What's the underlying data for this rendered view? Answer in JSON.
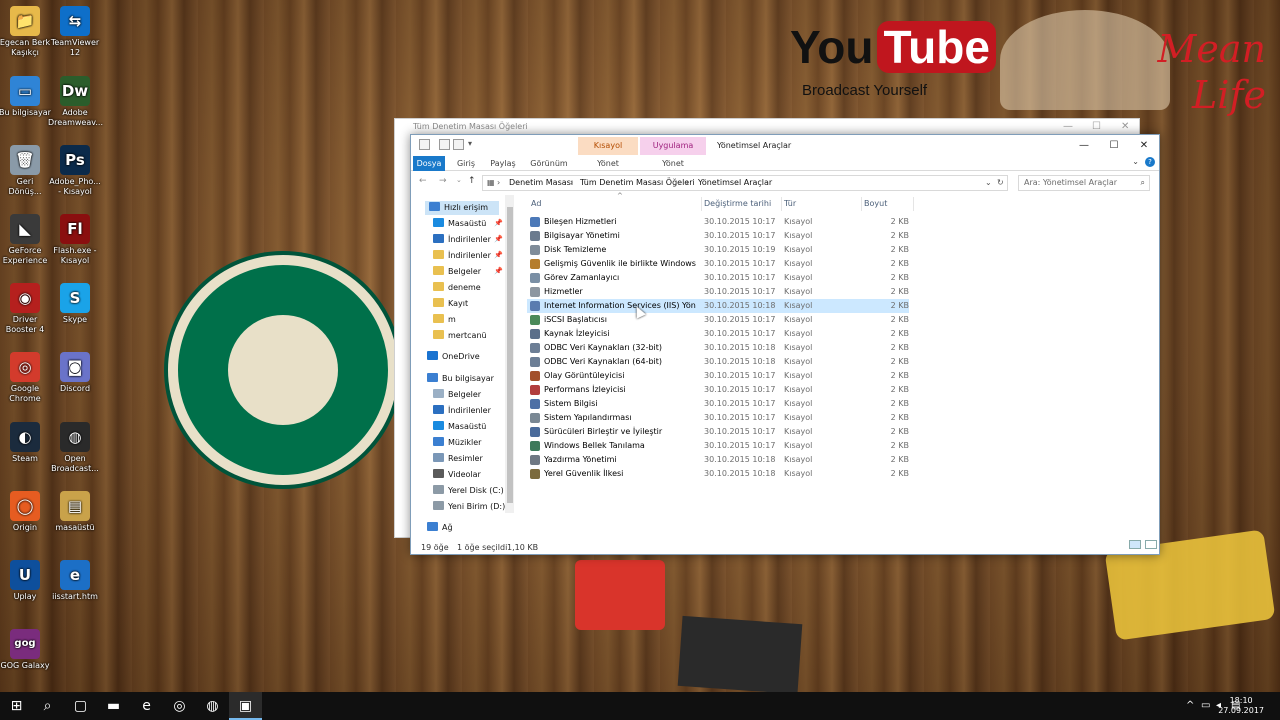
{
  "desktop": {
    "background_text": {
      "youtube_a": "You",
      "youtube_b": "Tube",
      "broadcast": "Broadcast Yourself",
      "mean": "Mean",
      "life": "Life"
    },
    "icons": [
      {
        "label": "Egecan Berk\nKaşıkçı",
        "glyph": "📁",
        "color": "#e7b94a"
      },
      {
        "label": "TeamViewer\n12",
        "glyph": "⇆",
        "color": "#0e6fc9"
      },
      {
        "label": "Bu bilgisayar",
        "glyph": "▭",
        "color": "#2f84d6"
      },
      {
        "label": "Adobe\nDreamweav...",
        "glyph": "Dw",
        "color": "#2b5d2b"
      },
      {
        "label": "Geri\nDönüş...",
        "glyph": "🗑",
        "color": "#8a9aa8"
      },
      {
        "label": "Adobe_Pho...\n- Kısayol",
        "glyph": "Ps",
        "color": "#0b2a4a"
      },
      {
        "label": "GeForce\nExperience",
        "glyph": "◣",
        "color": "#3a3a3a"
      },
      {
        "label": "Flash.exe -\nKısayol",
        "glyph": "Fl",
        "color": "#8a0f0f"
      },
      {
        "label": "Driver\nBooster 4",
        "glyph": "◉",
        "color": "#b5201e"
      },
      {
        "label": "Skype",
        "glyph": "S",
        "color": "#1aa3e8"
      },
      {
        "label": "Google\nChrome",
        "glyph": "◎",
        "color": "#d33b2c"
      },
      {
        "label": "Discord",
        "glyph": "◙",
        "color": "#6a73c9"
      },
      {
        "label": "Steam",
        "glyph": "◐",
        "color": "#1b2b3d"
      },
      {
        "label": "Open\nBroadcast...",
        "glyph": "◍",
        "color": "#2a2a2a"
      },
      {
        "label": "Origin",
        "glyph": "◯",
        "color": "#e65c21"
      },
      {
        "label": "masaüstü",
        "glyph": "▤",
        "color": "#c9a24a"
      },
      {
        "label": "Uplay",
        "glyph": "U",
        "color": "#0e4f9c"
      },
      {
        "label": "iisstart.htm",
        "glyph": "e",
        "color": "#1c6fc6"
      },
      {
        "label": "GOG Galaxy",
        "glyph": "gog",
        "color": "#7a2c7d"
      }
    ]
  },
  "ghost_window": {
    "title": "Tüm Denetim Masası Öğeleri"
  },
  "window": {
    "context_tabs": {
      "a": "Kısayol Araçları",
      "b": "Uygulama Araçları"
    },
    "title": "Yönetimsel Araçlar",
    "controls": {
      "minimize": "—",
      "maximize": "☐",
      "close": "✕"
    },
    "ribbon": {
      "tabs": [
        "Dosya",
        "Giriş",
        "Paylaş",
        "Görünüm",
        "Yönet",
        "Yönet"
      ]
    },
    "address": {
      "crumbs": [
        "Denetim Masası",
        "Tüm Denetim Masası Öğeleri",
        "Yönetimsel Araçlar"
      ],
      "search_placeholder": "Ara: Yönetimsel Araçlar"
    },
    "nav": [
      {
        "label": "Hızlı erişim",
        "color": "#3b7fd1",
        "selected": true
      },
      {
        "label": "Masaüstü",
        "color": "#1a8be0",
        "pin": true
      },
      {
        "label": "İndirilenler",
        "color": "#2b6fc0",
        "pin": true
      },
      {
        "label": "İndirilenler",
        "color": "#e9c050",
        "pin": true
      },
      {
        "label": "Belgeler",
        "color": "#e9c050",
        "pin": true
      },
      {
        "label": "deneme",
        "color": "#e9c050"
      },
      {
        "label": "Kayıt",
        "color": "#e9c050"
      },
      {
        "label": "m",
        "color": "#e9c050"
      },
      {
        "label": "mertcanü",
        "color": "#e9c050"
      },
      {
        "label": "OneDrive",
        "color": "#1a73d0"
      },
      {
        "label": "Bu bilgisayar",
        "color": "#3b7fd1"
      },
      {
        "label": "Belgeler",
        "color": "#9bb0c5"
      },
      {
        "label": "İndirilenler",
        "color": "#2b6fc0"
      },
      {
        "label": "Masaüstü",
        "color": "#1a8be0"
      },
      {
        "label": "Müzikler",
        "color": "#3b7fd1"
      },
      {
        "label": "Resimler",
        "color": "#7a97b7"
      },
      {
        "label": "Videolar",
        "color": "#5a5a5a"
      },
      {
        "label": "Yerel Disk (C:)",
        "color": "#8c9aa6"
      },
      {
        "label": "Yeni Birim (D:)",
        "color": "#8c9aa6"
      },
      {
        "label": "Ağ",
        "color": "#3b7fd1"
      }
    ],
    "columns": {
      "name": "Ad",
      "date": "Değiştirme tarihi",
      "type": "Tür",
      "size": "Boyut"
    },
    "rows": [
      {
        "name": "Bileşen Hizmetleri",
        "date": "30.10.2015 10:17",
        "type": "Kısayol",
        "size": "2 KB",
        "color": "#4c79b8"
      },
      {
        "name": "Bilgisayar Yönetimi",
        "date": "30.10.2015 10:17",
        "type": "Kısayol",
        "size": "2 KB",
        "color": "#6b7b8e"
      },
      {
        "name": "Disk Temizleme",
        "date": "30.10.2015 10:19",
        "type": "Kısayol",
        "size": "2 KB",
        "color": "#7f8c99"
      },
      {
        "name": "Gelişmiş Güvenlik ile birlikte Windows Gü...",
        "date": "30.10.2015 10:17",
        "type": "Kısayol",
        "size": "2 KB",
        "color": "#b57d2c"
      },
      {
        "name": "Görev Zamanlayıcı",
        "date": "30.10.2015 10:17",
        "type": "Kısayol",
        "size": "2 KB",
        "color": "#7a8fa5"
      },
      {
        "name": "Hizmetler",
        "date": "30.10.2015 10:17",
        "type": "Kısayol",
        "size": "2 KB",
        "color": "#8d96a0"
      },
      {
        "name": "Internet Information Services (IIS) Yönetic...",
        "date": "30.10.2015 10:18",
        "type": "Kısayol",
        "size": "2 KB",
        "color": "#5a7cb0",
        "selected": true
      },
      {
        "name": "iSCSI Başlatıcısı",
        "date": "30.10.2015 10:17",
        "type": "Kısayol",
        "size": "2 KB",
        "color": "#4a8a5a"
      },
      {
        "name": "Kaynak İzleyicisi",
        "date": "30.10.2015 10:17",
        "type": "Kısayol",
        "size": "2 KB",
        "color": "#5b6f8a"
      },
      {
        "name": "ODBC Veri Kaynakları (32-bit)",
        "date": "30.10.2015 10:18",
        "type": "Kısayol",
        "size": "2 KB",
        "color": "#6c7e95"
      },
      {
        "name": "ODBC Veri Kaynakları (64-bit)",
        "date": "30.10.2015 10:18",
        "type": "Kısayol",
        "size": "2 KB",
        "color": "#6c7e95"
      },
      {
        "name": "Olay Görüntüleyicisi",
        "date": "30.10.2015 10:17",
        "type": "Kısayol",
        "size": "2 KB",
        "color": "#a2502b"
      },
      {
        "name": "Performans İzleyicisi",
        "date": "30.10.2015 10:17",
        "type": "Kısayol",
        "size": "2 KB",
        "color": "#b23d3d"
      },
      {
        "name": "Sistem Bilgisi",
        "date": "30.10.2015 10:17",
        "type": "Kısayol",
        "size": "2 KB",
        "color": "#4d6fa5"
      },
      {
        "name": "Sistem Yapılandırması",
        "date": "30.10.2015 10:17",
        "type": "Kısayol",
        "size": "2 KB",
        "color": "#7a8894"
      },
      {
        "name": "Sürücüleri Birleştir ve İyileştir",
        "date": "30.10.2015 10:17",
        "type": "Kısayol",
        "size": "2 KB",
        "color": "#4a6b9b"
      },
      {
        "name": "Windows Bellek Tanılama",
        "date": "30.10.2015 10:17",
        "type": "Kısayol",
        "size": "2 KB",
        "color": "#3d7a5b"
      },
      {
        "name": "Yazdırma Yönetimi",
        "date": "30.10.2015 10:18",
        "type": "Kısayol",
        "size": "2 KB",
        "color": "#6f7883"
      },
      {
        "name": "Yerel Güvenlik İlkesi",
        "date": "30.10.2015 10:18",
        "type": "Kısayol",
        "size": "2 KB",
        "color": "#7b6a3d"
      }
    ],
    "status": {
      "count": "19 öğe",
      "selected": "1 öğe seçildi",
      "size": "1,10 KB"
    }
  },
  "taskbar": {
    "items": [
      {
        "name": "start-button",
        "glyph": "⊞"
      },
      {
        "name": "search-button",
        "glyph": "⌕"
      },
      {
        "name": "task-view-button",
        "glyph": "▢"
      },
      {
        "name": "file-explorer-taskbar",
        "glyph": "▬"
      },
      {
        "name": "edge-taskbar",
        "glyph": "e"
      },
      {
        "name": "chrome-taskbar",
        "glyph": "◎"
      },
      {
        "name": "obs-taskbar",
        "glyph": "◍"
      },
      {
        "name": "control-panel-taskbar",
        "glyph": "▣",
        "active": true
      }
    ],
    "time": "18:10",
    "date": "27.09.2017"
  },
  "colors": {
    "accent": "#1979ca",
    "selection": "#cce8ff",
    "taskbar": "#101010"
  }
}
